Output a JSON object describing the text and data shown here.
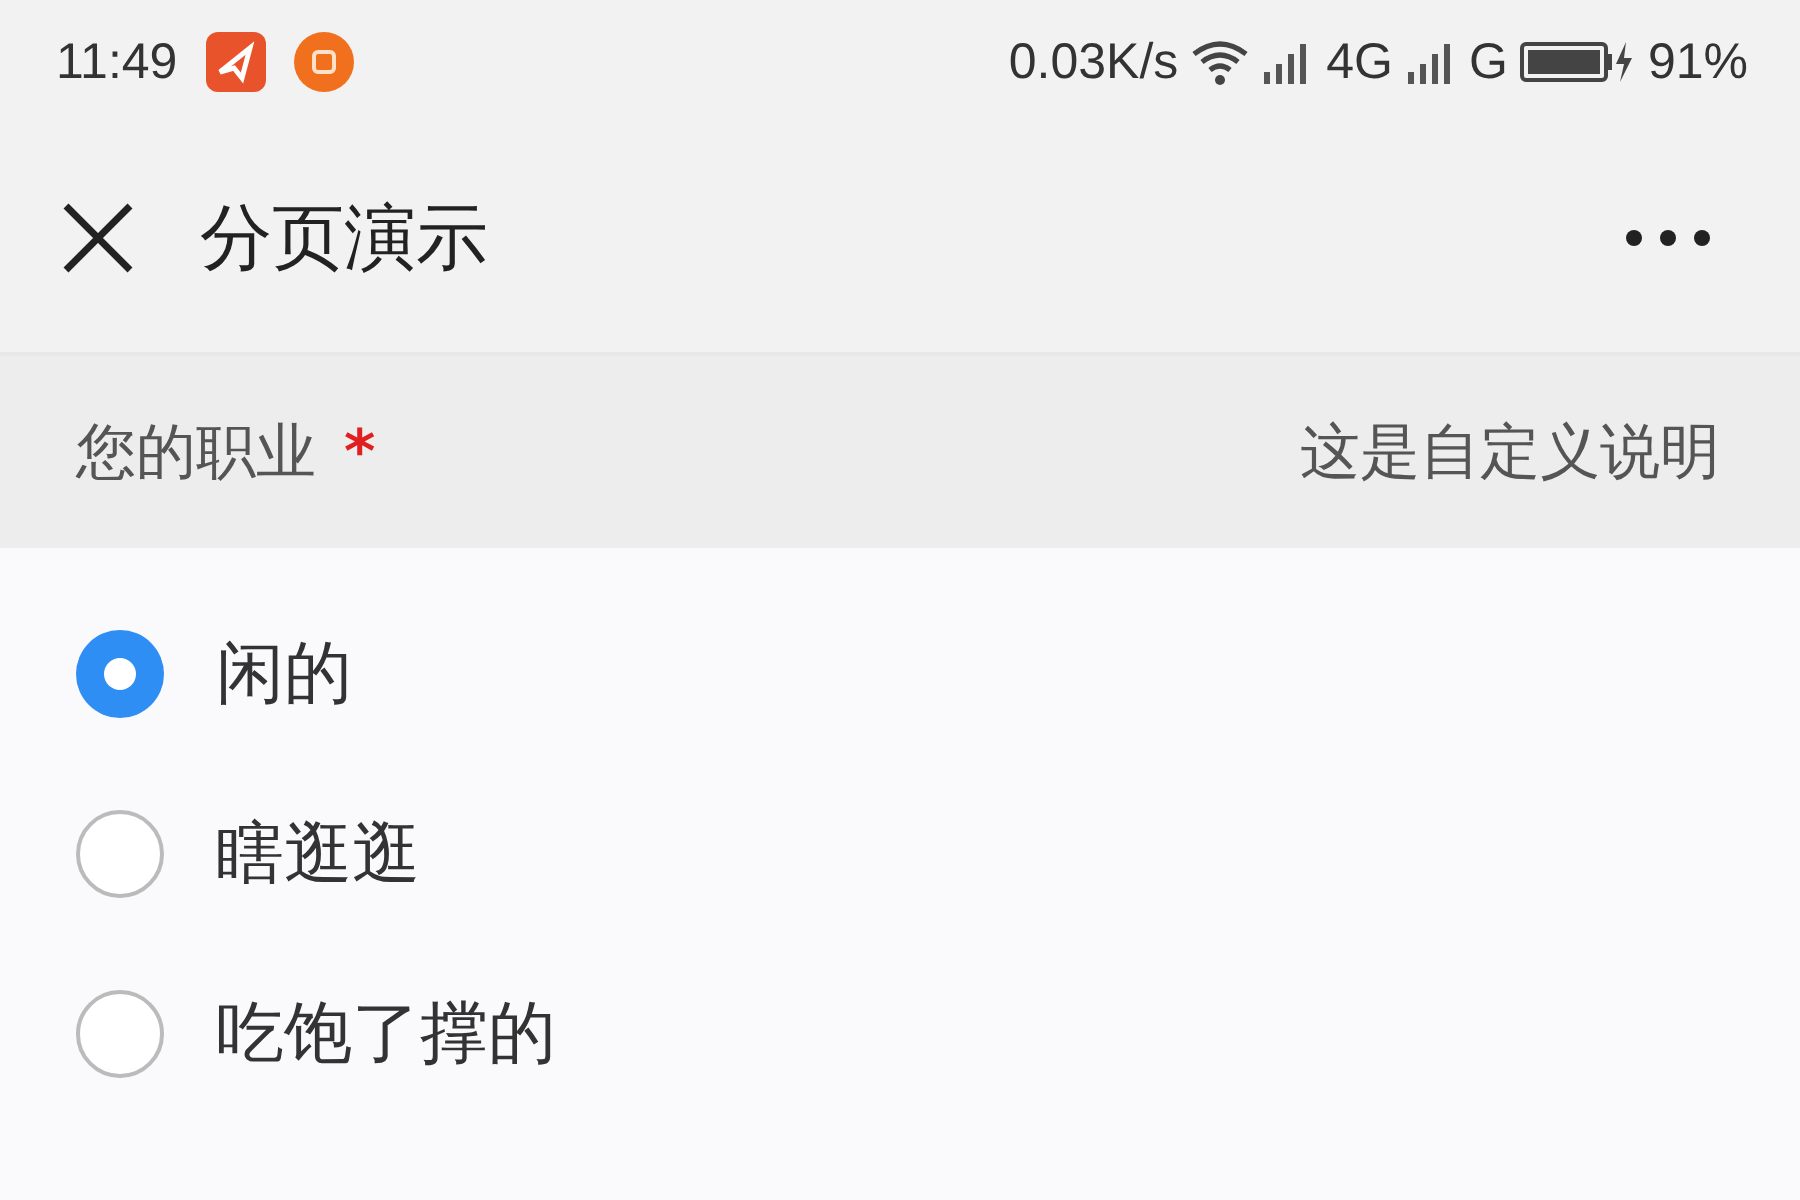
{
  "status_bar": {
    "time": "11:49",
    "speed": "0.03K/s",
    "network_1": "4G",
    "network_2": "G",
    "battery": "91%"
  },
  "nav_bar": {
    "title": "分页演示"
  },
  "question": {
    "label": "您的职业",
    "required": true,
    "required_mark": "*",
    "description": "这是自定义说明"
  },
  "options": [
    {
      "label": "闲的",
      "selected": true
    },
    {
      "label": "瞎逛逛",
      "selected": false
    },
    {
      "label": "吃饱了撑的",
      "selected": false
    }
  ]
}
